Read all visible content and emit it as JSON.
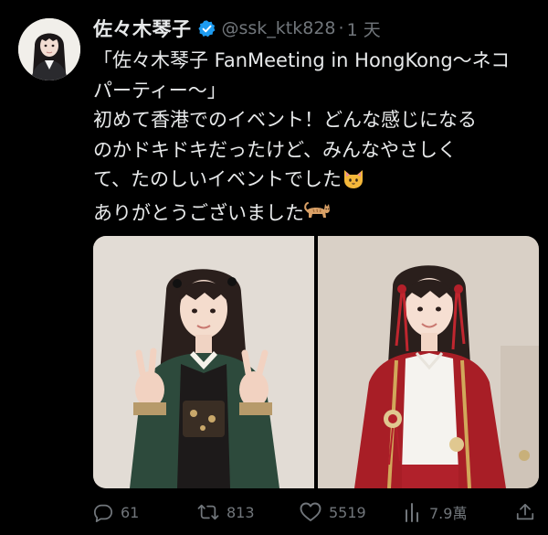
{
  "tweet": {
    "display_name": "佐々木琴子",
    "handle": "@ssk_ktk828",
    "separator": "·",
    "time": "1 天",
    "text_lines": [
      "「佐々木琴子 FanMeeting in HongKong～ネコ",
      "パーティー～」",
      "初めて香港でのイベント！どんな感じになる",
      "のかドキドキだったけど、みんなやさしく",
      "て、たのしいイベントでした",
      "ありがとうございました"
    ],
    "emoji": [
      "cat-face-emoji",
      "cat-emoji"
    ]
  },
  "actions": {
    "reply_count": "61",
    "retweet_count": "813",
    "like_count": "5519",
    "views_count": "7.9萬"
  },
  "icons": [
    "verified-badge-icon",
    "reply-icon",
    "retweet-icon",
    "like-icon",
    "views-icon",
    "share-icon"
  ],
  "colors": {
    "background": "#000000",
    "text": "#e7e9ea",
    "muted": "#71767b",
    "verified": "#1d9bf0"
  }
}
